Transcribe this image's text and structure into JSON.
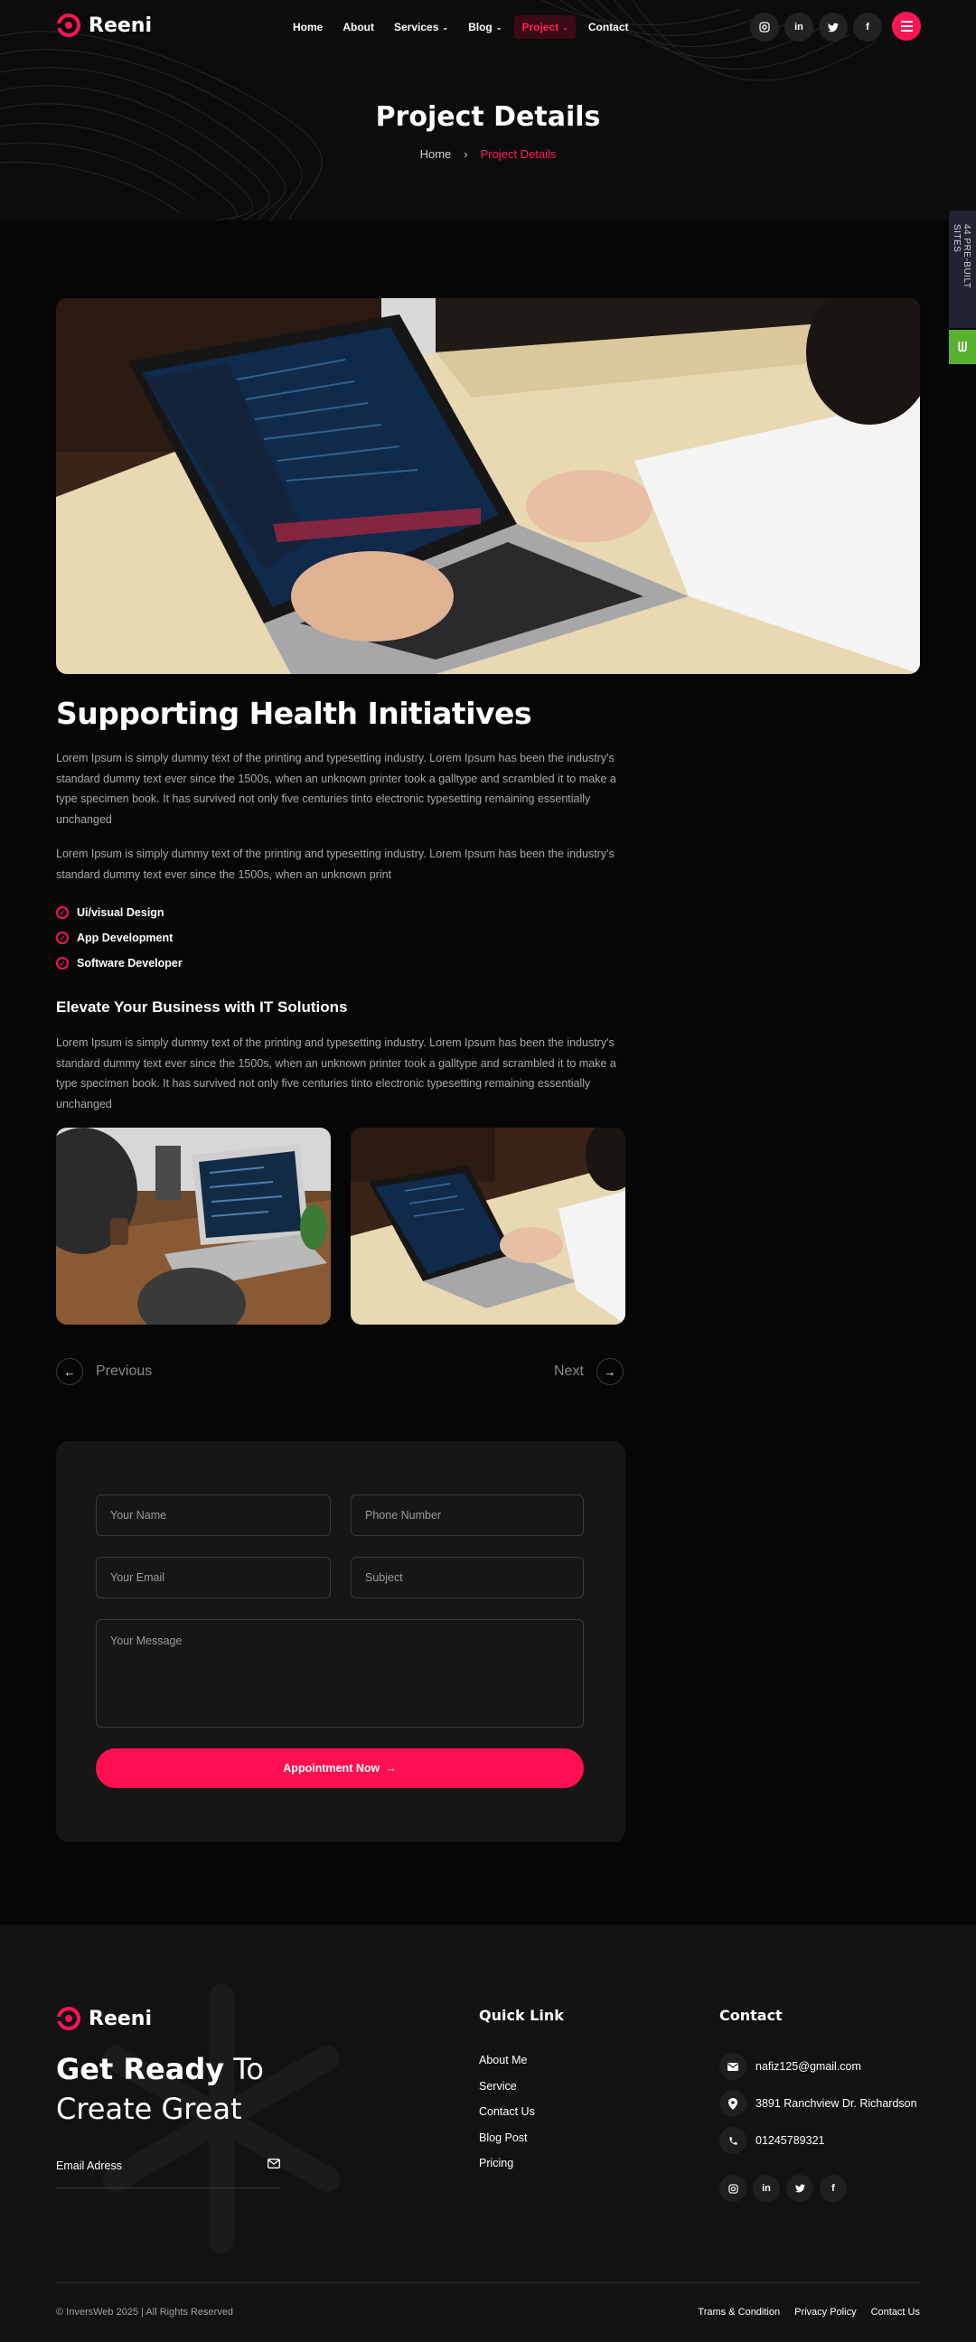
{
  "brand": {
    "name": "Reeni"
  },
  "nav": {
    "items": [
      {
        "label": "Home",
        "dropdown": false,
        "active": false
      },
      {
        "label": "About",
        "dropdown": false,
        "active": false
      },
      {
        "label": "Services",
        "dropdown": true,
        "active": false
      },
      {
        "label": "Blog",
        "dropdown": true,
        "active": false
      },
      {
        "label": "Project",
        "dropdown": true,
        "active": true
      },
      {
        "label": "Contact",
        "dropdown": false,
        "active": false
      }
    ]
  },
  "social": [
    "instagram-icon",
    "linkedin-icon",
    "twitter-icon",
    "facebook-icon"
  ],
  "hero": {
    "title": "Project Details",
    "breadcrumb_home": "Home",
    "breadcrumb_separator": "›",
    "breadcrumb_current": "Project Details"
  },
  "side_tab": {
    "label": "44 PRE-BUILT SITES"
  },
  "project": {
    "title": "Supporting Health Initiatives",
    "para1": "Lorem Ipsum is simply dummy text of the printing and typesetting industry. Lorem Ipsum has been the industry's standard dummy text ever since the 1500s, when an unknown printer took a galltype and scrambled it to make a type specimen book. It has survived not only five centuries tinto electronic typesetting remaining essentially unchanged",
    "para2": "Lorem Ipsum is simply dummy text of the printing and typesetting industry. Lorem Ipsum has been the industry's standard dummy text ever since the 1500s, when an unknown print",
    "checklist": [
      "Ui/visual Design",
      "App Development",
      "Software Developer"
    ],
    "subheading": "Elevate Your Business with IT Solutions",
    "para3": "Lorem Ipsum is simply dummy text of the printing and typesetting industry. Lorem Ipsum has been the industry's standard dummy text ever since the 1500s, when an unknown printer took a galltype and scrambled it to make a type specimen book. It has survived not only five centuries tinto electronic typesetting remaining essentially unchanged"
  },
  "pager": {
    "prev": "Previous",
    "next": "Next"
  },
  "form": {
    "name_placeholder": "Your Name",
    "phone_placeholder": "Phone Number",
    "email_placeholder": "Your Email",
    "subject_placeholder": "Subject",
    "message_placeholder": "Your Message",
    "submit_label": "Appointment Now",
    "submit_arrow": "→"
  },
  "footer": {
    "tagline_bold": "Get Ready",
    "tagline_rest1": " To",
    "tagline_line2": "Create Great",
    "email_label": "Email Adress",
    "quick_heading": "Quick Link",
    "quick_links": [
      "About Me",
      "Service",
      "Contact Us",
      "Blog Post",
      "Pricing"
    ],
    "contact_heading": "Contact",
    "contact_email": "nafiz125@gmail.com",
    "contact_address": "3891 Ranchview Dr. Richardson",
    "contact_phone": "01245789321",
    "copyright": "© InversWeb 2025 | All Rights Reserved",
    "legal_links": [
      "Trams & Condition",
      "Privacy Policy",
      "Contact Us"
    ]
  },
  "colors": {
    "accent": "#ff1454",
    "background": "#060606",
    "footer_bg": "#121212",
    "card_bg": "#161616",
    "side_green": "#58b12d"
  }
}
